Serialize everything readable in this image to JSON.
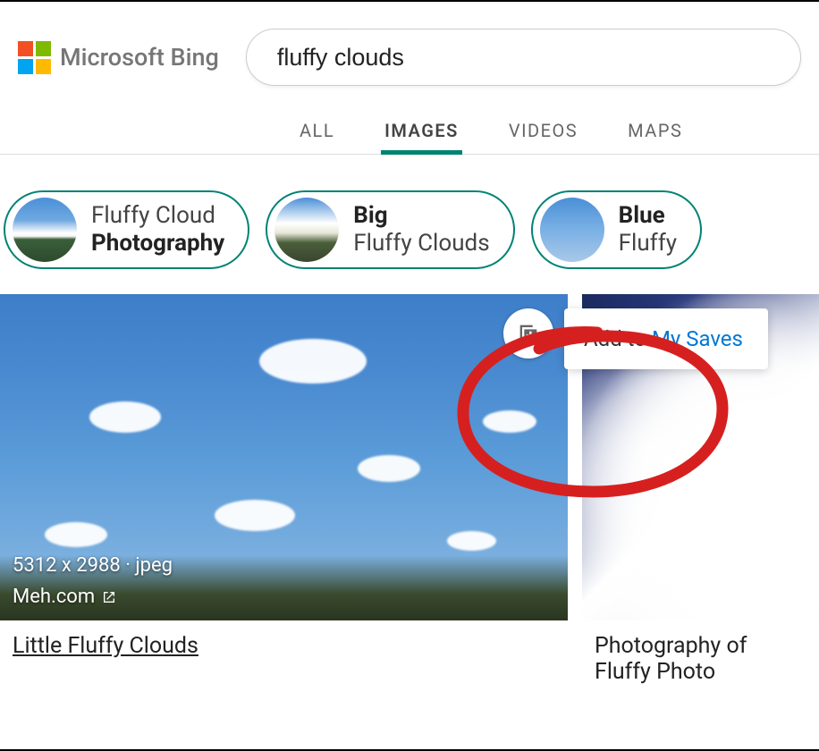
{
  "brand": "Microsoft Bing",
  "search": {
    "value": "fluffy clouds"
  },
  "tabs": [
    {
      "label": "ALL",
      "active": false
    },
    {
      "label": "IMAGES",
      "active": true
    },
    {
      "label": "VIDEOS",
      "active": false
    },
    {
      "label": "MAPS",
      "active": false
    }
  ],
  "suggestions": [
    {
      "line1": "Fluffy Cloud",
      "line2_bold": "Photography"
    },
    {
      "line1_bold": "Big",
      "line2": "Fluffy Clouds"
    },
    {
      "line1_bold": "Blue",
      "line2": "Fluffy"
    }
  ],
  "results": [
    {
      "dimensions": "5312 x 2988 · jpeg",
      "source": "Meh.com",
      "caption": "Little Fluffy Clouds"
    },
    {
      "caption": "Photography of Fluffy Photo"
    }
  ],
  "save_tooltip": {
    "prefix": "Add to ",
    "link": "My Saves"
  }
}
